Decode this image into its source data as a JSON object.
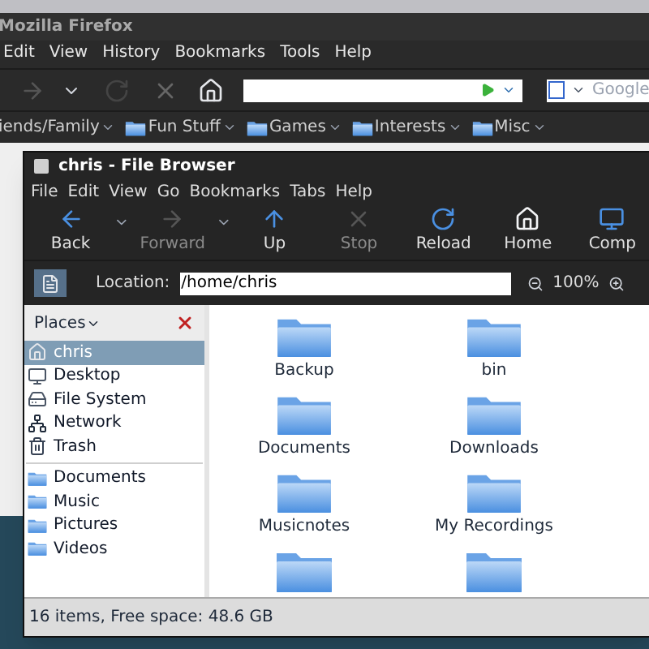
{
  "firefox": {
    "title": "Mozilla Firefox",
    "menu": [
      "Edit",
      "View",
      "History",
      "Bookmarks",
      "Tools",
      "Help"
    ],
    "search": {
      "placeholder": "Google"
    },
    "bookmarks": [
      "iends/Family",
      "Fun Stuff",
      "Games",
      "Interests",
      "Misc"
    ]
  },
  "file_browser": {
    "title": "chris - File Browser",
    "menu": [
      "File",
      "Edit",
      "View",
      "Go",
      "Bookmarks",
      "Tabs",
      "Help"
    ],
    "toolbar": [
      {
        "label": "Back",
        "kind": "back",
        "disabled": false,
        "dropdown": true
      },
      {
        "label": "Forward",
        "kind": "forward",
        "disabled": true,
        "dropdown": true
      },
      {
        "label": "Up",
        "kind": "up",
        "disabled": false,
        "dropdown": false
      },
      {
        "label": "Stop",
        "kind": "stop",
        "disabled": true,
        "dropdown": false
      },
      {
        "label": "Reload",
        "kind": "reload",
        "disabled": false,
        "dropdown": false
      },
      {
        "label": "Home",
        "kind": "home",
        "disabled": false,
        "dropdown": false
      },
      {
        "label": "Comp",
        "kind": "computer",
        "disabled": false,
        "dropdown": false
      }
    ],
    "location": {
      "label": "Location:",
      "value": "/home/chris"
    },
    "zoom": "100%",
    "places": {
      "title": "Places",
      "devices": [
        {
          "label": "chris",
          "kind": "home",
          "selected": true
        },
        {
          "label": "Desktop",
          "kind": "desktop",
          "selected": false
        },
        {
          "label": "File System",
          "kind": "drive",
          "selected": false
        },
        {
          "label": "Network",
          "kind": "network",
          "selected": false
        },
        {
          "label": "Trash",
          "kind": "trash",
          "selected": false
        }
      ],
      "bookmarks": [
        {
          "label": "Documents",
          "kind": "folder",
          "selected": false
        },
        {
          "label": "Music",
          "kind": "folder",
          "selected": false
        },
        {
          "label": "Pictures",
          "kind": "folder",
          "selected": false
        },
        {
          "label": "Videos",
          "kind": "folder",
          "selected": false
        }
      ]
    },
    "files": [
      {
        "kind": "folder",
        "name": "Backup"
      },
      {
        "kind": "folder",
        "name": "bin"
      },
      {
        "kind": "folder",
        "name": "Documents"
      },
      {
        "kind": "folder",
        "name": "Downloads"
      },
      {
        "kind": "folder",
        "name": "Musicnotes"
      },
      {
        "kind": "folder",
        "name": "My Recordings"
      },
      {
        "kind": "partial"
      },
      {
        "kind": "partial"
      }
    ],
    "status": "16 items, Free space: 48.6 GB"
  }
}
